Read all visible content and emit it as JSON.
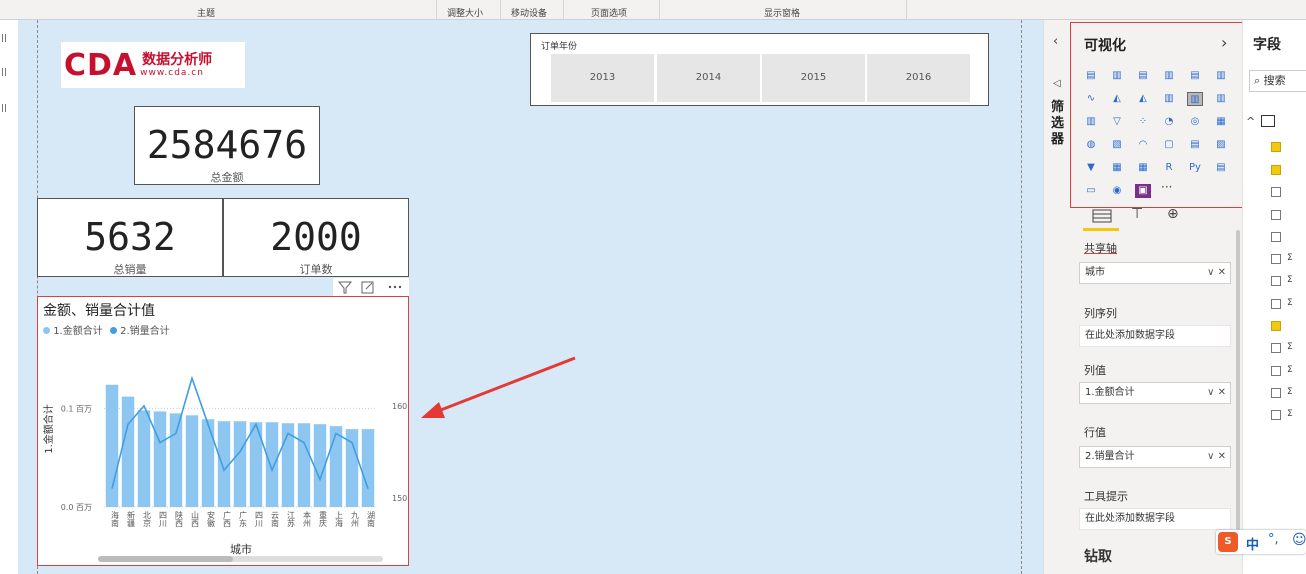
{
  "ribbon": {
    "groups": [
      "主题",
      "调整大小",
      "移动设备",
      "页面选项",
      "显示窗格"
    ]
  },
  "kpis": {
    "total_amount": {
      "value": "2584676",
      "label": "总金额"
    },
    "total_sales": {
      "value": "5632",
      "label": "总销量"
    },
    "order_count": {
      "value": "2000",
      "label": "订单数"
    }
  },
  "logo": {
    "brand": "CDA",
    "cn": "数据分析师",
    "url": "www.cda.cn"
  },
  "slicer": {
    "title": "订单年份",
    "years": [
      "2013",
      "2014",
      "2015",
      "2016"
    ]
  },
  "chart_data": {
    "type": "bar",
    "title": "金额、销量合计值",
    "legend": [
      "1.金额合计",
      "2.销量合计"
    ],
    "series_colors": [
      "#8ec6f2",
      "#3f9fe0"
    ],
    "xlabel": "城市",
    "ylabel": "1.金额合计",
    "y_ticks": [
      "0.0 百万",
      "0.1 百万"
    ],
    "y2_ticks": [
      "150",
      "160"
    ],
    "categories": [
      "海南",
      "新疆",
      "北京",
      "四川",
      "陕西",
      "山西",
      "安徽",
      "广西",
      "广东",
      "四川",
      "云南",
      "江苏",
      "本州",
      "重庆",
      "上海",
      "九州",
      "湖南"
    ],
    "series": [
      {
        "name": "1.金额合计",
        "type": "bar",
        "values": [
          0.124,
          0.112,
          0.098,
          0.097,
          0.095,
          0.093,
          0.089,
          0.087,
          0.087,
          0.086,
          0.086,
          0.085,
          0.085,
          0.084,
          0.082,
          0.079,
          0.079
        ]
      },
      {
        "name": "2.销量合计",
        "type": "line",
        "values": [
          151,
          158,
          160,
          156,
          157,
          163,
          158,
          153,
          155,
          158,
          153,
          157,
          156,
          152,
          157,
          156,
          151
        ]
      }
    ],
    "ylim": [
      0,
      0.14
    ],
    "y2lim": [
      149,
      164
    ]
  },
  "viz_pane": {
    "title": "可视化",
    "shared_axis_label": "共享轴",
    "shared_axis_value": "城市",
    "column_series_label": "列序列",
    "column_series_placeholder": "在此处添加数据字段",
    "column_values_label": "列值",
    "column_values_value": "1.金额合计",
    "line_values_label": "行值",
    "line_values_value": "2.销量合计",
    "tooltips_label": "工具提示",
    "tooltips_placeholder": "在此处添加数据字段",
    "drill_label": "钻取",
    "more_label": "···"
  },
  "filter_pane": {
    "title": "筛选器"
  },
  "fields_pane": {
    "title": "字段",
    "search_label": "搜索"
  },
  "ime": {
    "label": "中"
  },
  "field_checks": [
    true,
    true,
    false,
    false,
    false,
    false,
    false,
    false,
    true,
    false,
    false,
    false,
    false
  ]
}
